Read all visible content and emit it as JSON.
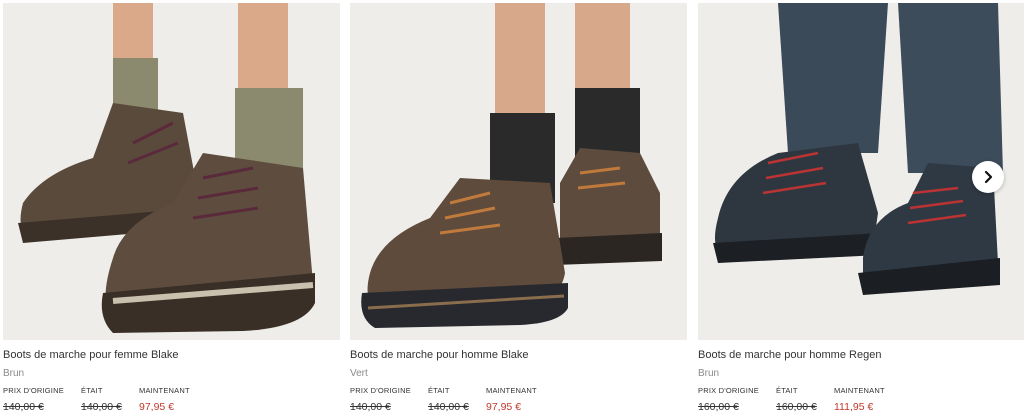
{
  "products": [
    {
      "title": "Boots de marche pour femme Blake",
      "color": "Brun",
      "labels": {
        "original": "PRIX D'ORIGINE",
        "was": "ÉTAIT",
        "now": "MAINTENANT"
      },
      "original_price": "140,00 €",
      "was_price": "140,00 €",
      "now_price": "97,95 €",
      "image_icon": "product-photo-womens-brown-hiking-boots"
    },
    {
      "title": "Boots de marche pour homme Blake",
      "color": "Vert",
      "labels": {
        "original": "PRIX D'ORIGINE",
        "was": "ÉTAIT",
        "now": "MAINTENANT"
      },
      "original_price": "140,00 €",
      "was_price": "140,00 €",
      "now_price": "97,95 €",
      "image_icon": "product-photo-mens-brown-hiking-boots"
    },
    {
      "title": "Boots de marche pour homme Regen",
      "color": "Brun",
      "labels": {
        "original": "PRIX D'ORIGINE",
        "was": "ÉTAIT",
        "now": "MAINTENANT"
      },
      "original_price": "160,00 €",
      "was_price": "160,00 €",
      "now_price": "111,95 €",
      "image_icon": "product-photo-mens-dark-hiking-boots"
    }
  ],
  "carousel": {
    "next_icon": "chevron-right-icon"
  },
  "colors": {
    "sale": "#c0392b",
    "image_bg": "#efede9"
  }
}
